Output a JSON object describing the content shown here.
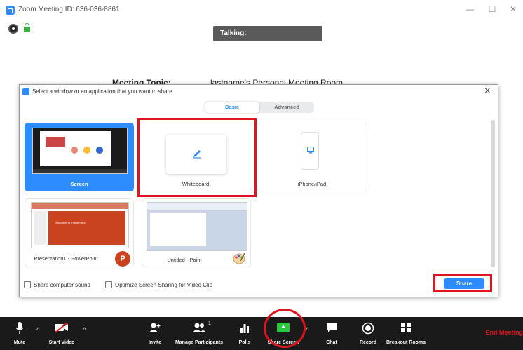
{
  "window": {
    "title": "Zoom Meeting ID: 636-036-8861",
    "minimize_glyph": "—",
    "maximize_glyph": "☐",
    "close_glyph": "✕"
  },
  "status": {
    "talking_label": "Talking:"
  },
  "meeting": {
    "topic_label": "Meeting Topic:",
    "topic_value": "lastname's Personal Meeting Room"
  },
  "share_dialog": {
    "title": "Select a window or an application that you want to share",
    "close_glyph": "✕",
    "tabs": [
      {
        "label": "Basic",
        "selected": true
      },
      {
        "label": "Advanced",
        "selected": false
      }
    ],
    "sources": [
      {
        "label": "Screen",
        "selected": true,
        "icon": "screen-thumbnail"
      },
      {
        "label": "Whiteboard",
        "selected": false,
        "icon": "pencil-icon",
        "highlighted": true
      },
      {
        "label": "iPhone/iPad",
        "selected": false,
        "icon": "airplay-icon"
      },
      {
        "label": "Presentation1 - PowerPoint",
        "selected": false,
        "icon": "powerpoint-icon",
        "badge": "P"
      },
      {
        "label": "Untitled - Paint",
        "selected": false,
        "icon": "paint-icon"
      }
    ],
    "ppt_slide_text": "Welcome to PowerPoint",
    "options": {
      "share_sound_label": "Share computer sound",
      "optimize_label": "Optimize Screen Sharing for Video Clip"
    },
    "share_button_label": "Share",
    "accent_color": "#2d8cff",
    "highlight_color": "#e0141e"
  },
  "toolbar": {
    "mute": "Mute",
    "start_video": "Start Video",
    "invite": "Invite",
    "manage_participants": "Manage Participants",
    "participant_count": "1",
    "polls": "Polls",
    "share_screen": "Share Screen",
    "chat": "Chat",
    "record": "Record",
    "breakout_rooms": "Breakout Rooms",
    "end_meeting": "End Meeting",
    "caret_glyph": "^"
  }
}
